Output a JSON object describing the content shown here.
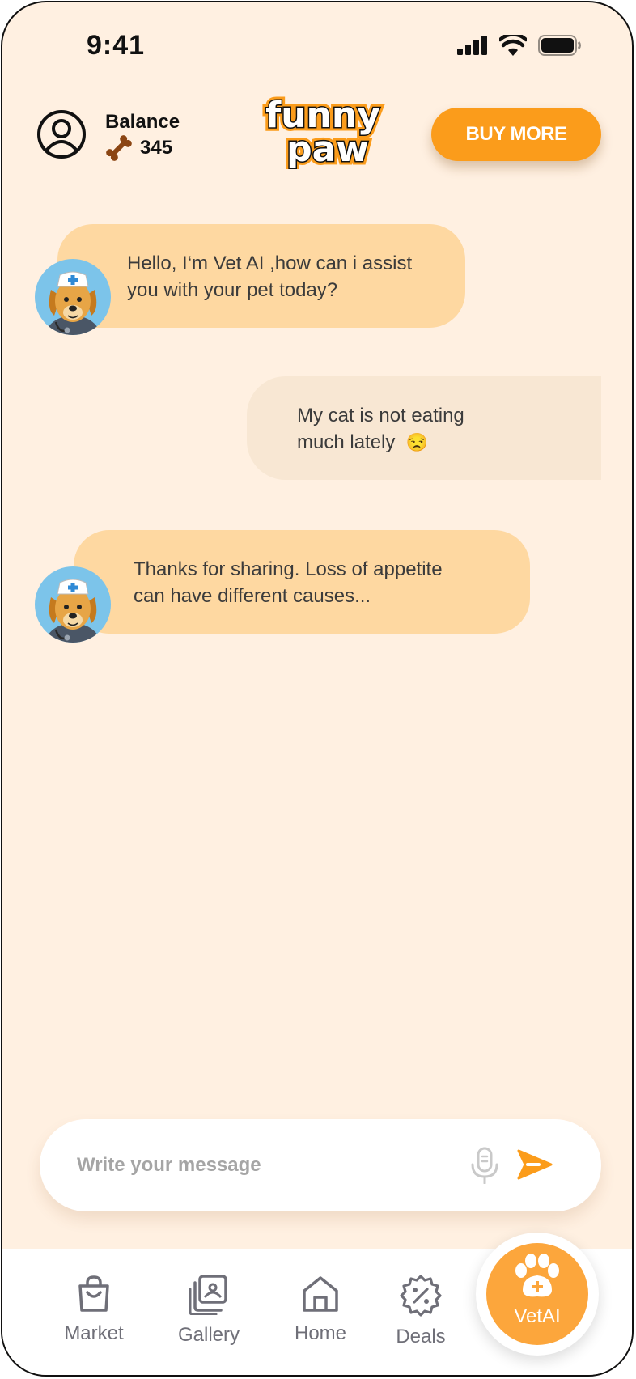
{
  "status_bar": {
    "time": "9:41"
  },
  "header": {
    "balance_label": "Balance",
    "balance_value": "345",
    "logo_text_line1": "funny",
    "logo_text_line2": "paw",
    "buy_more_label": "BUY MORE"
  },
  "messages": [
    {
      "sender": "ai",
      "text_line1": "Hello, I‘m Vet AI ,how can i assist",
      "text_line2": "you with your pet today?"
    },
    {
      "sender": "user",
      "text_line1": "My cat is not eating",
      "text_line2": "much lately",
      "emoji": "😒"
    },
    {
      "sender": "ai",
      "text_line1": "Thanks for sharing. Loss of appetite",
      "text_line2": "can have different causes..."
    }
  ],
  "composer": {
    "placeholder": "Write your message"
  },
  "nav": {
    "items": [
      {
        "label": "Market",
        "icon": "shopping-bag-icon"
      },
      {
        "label": "Gallery",
        "icon": "gallery-icon"
      },
      {
        "label": "Home",
        "icon": "home-icon"
      },
      {
        "label": "Deals",
        "icon": "discount-badge-icon"
      },
      {
        "label": "VetAI",
        "icon": "paw-plus-icon"
      }
    ]
  },
  "colors": {
    "background": "#fff0e1",
    "accent": "#fb9c1b",
    "ai_bubble": "#fed8a1",
    "user_bubble": "#f8e7d3",
    "nav_text": "#6f6f78"
  }
}
